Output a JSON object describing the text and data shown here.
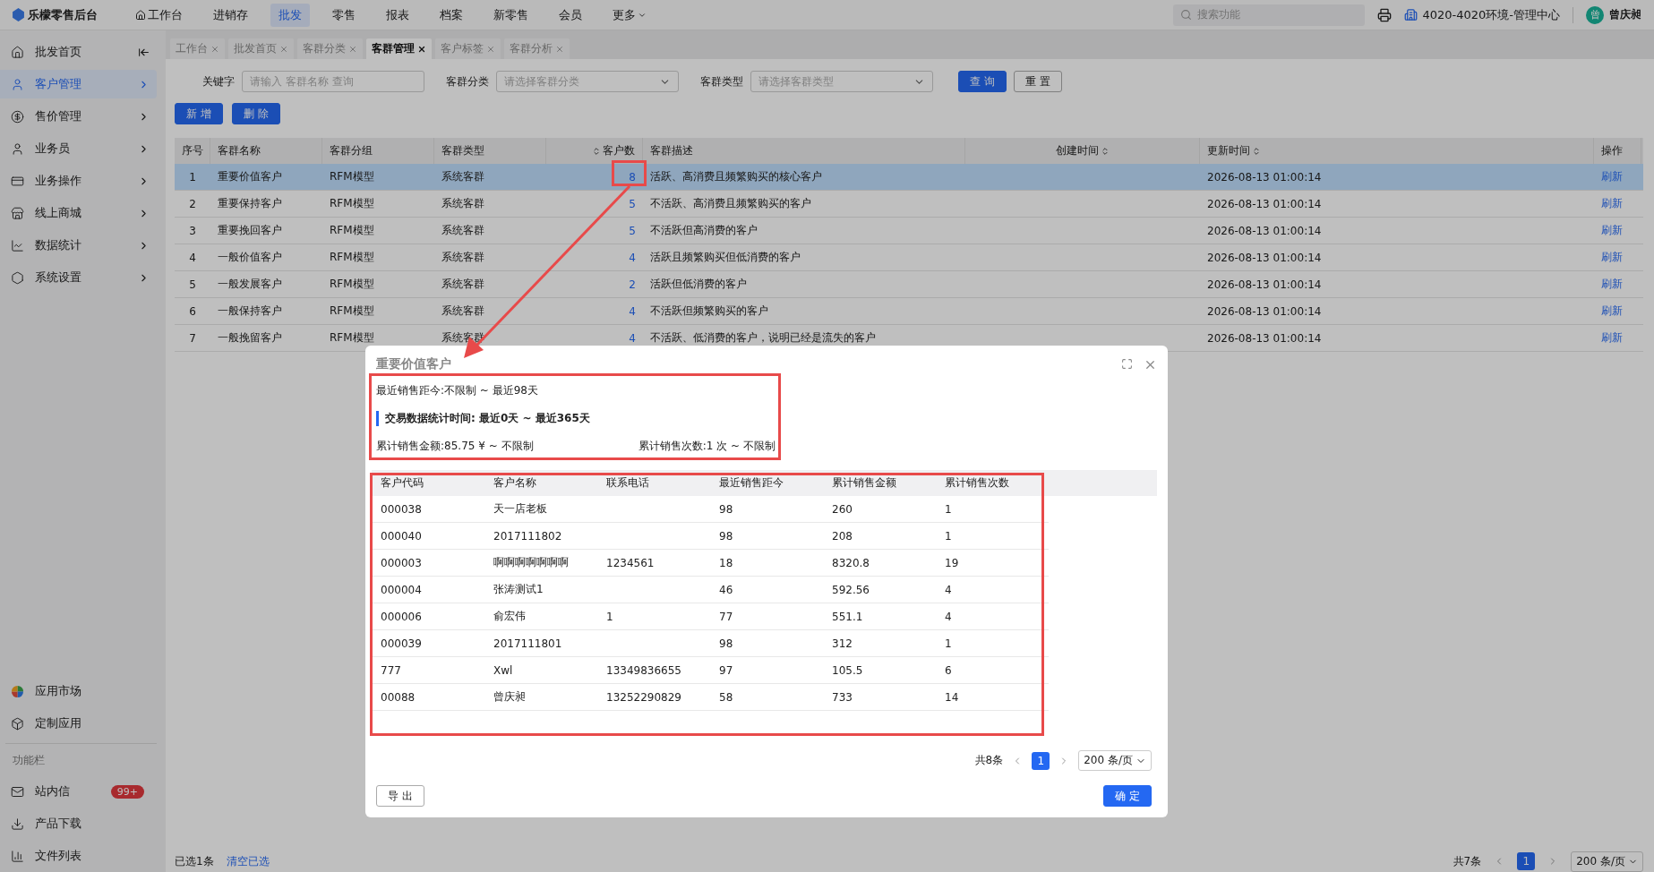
{
  "top_nav": {
    "brand": "乐檬零售后台",
    "items": [
      {
        "label": "工作台",
        "kind": "home",
        "selected": false
      },
      {
        "label": "进销存",
        "kind": "plain",
        "selected": false
      },
      {
        "label": "批发",
        "kind": "plain",
        "selected": true
      },
      {
        "label": "零售",
        "kind": "plain",
        "selected": false
      },
      {
        "label": "报表",
        "kind": "plain",
        "selected": false
      },
      {
        "label": "档案",
        "kind": "plain",
        "selected": false
      },
      {
        "label": "新零售",
        "kind": "plain",
        "selected": false
      },
      {
        "label": "会员",
        "kind": "plain",
        "selected": false
      },
      {
        "label": "更多",
        "kind": "more",
        "selected": false
      }
    ],
    "search": {
      "placeholder": "搜索功能"
    },
    "environment": "4020-4020环境-管理中心",
    "avatar": "曾",
    "user": "曾庆昶"
  },
  "sidebar": {
    "items": [
      {
        "label": "批发首页",
        "selected": false
      },
      {
        "label": "客户管理",
        "selected": true
      },
      {
        "label": "售价管理",
        "selected": false
      },
      {
        "label": "业务员",
        "selected": false
      },
      {
        "label": "业务操作",
        "selected": false
      },
      {
        "label": "线上商城",
        "selected": false
      },
      {
        "label": "数据统计",
        "selected": false
      },
      {
        "label": "系统设置",
        "selected": false
      }
    ],
    "apps": [
      {
        "label": "应用市场"
      },
      {
        "label": "定制应用"
      }
    ],
    "section_label": "功能栏",
    "tools": [
      {
        "label": "站内信",
        "badge": "99+"
      },
      {
        "label": "产品下载"
      },
      {
        "label": "文件列表"
      }
    ]
  },
  "tabs": [
    {
      "label": "工作台",
      "selected": false
    },
    {
      "label": "批发首页",
      "selected": false
    },
    {
      "label": "客群分类",
      "selected": false
    },
    {
      "label": "客群管理",
      "selected": true
    },
    {
      "label": "客户标签",
      "selected": false
    },
    {
      "label": "客群分析",
      "selected": false
    }
  ],
  "filters": [
    {
      "label": "关键字",
      "placeholder": "请输入 客群名称 查询",
      "kind": "input"
    },
    {
      "label": "客群分类",
      "placeholder": "请选择客群分类",
      "kind": "select"
    },
    {
      "label": "客群类型",
      "placeholder": "请选择客群类型",
      "kind": "select"
    }
  ],
  "filter_buttons": [
    {
      "label": "查 询",
      "kind": "primary"
    },
    {
      "label": "重 置",
      "kind": "default"
    }
  ],
  "actions": [
    "新 增",
    "删 除"
  ],
  "table": {
    "columns": [
      {
        "label": "序号",
        "sortable": false
      },
      {
        "label": "客群名称",
        "sortable": false
      },
      {
        "label": "客群分组",
        "sortable": false
      },
      {
        "label": "客群类型",
        "sortable": false
      },
      {
        "label": "客户数",
        "sortable": true
      },
      {
        "label": "客群描述",
        "sortable": false
      },
      {
        "label": "创建时间",
        "sortable": true
      },
      {
        "label": "更新时间",
        "sortable": true
      },
      {
        "label": "操作",
        "sortable": false
      }
    ],
    "rows": [
      {
        "index": "1",
        "name": "重要价值客户",
        "group": "RFM模型",
        "type": "系统客群",
        "count": "8",
        "description": "活跃、高消费且频繁购买的核心客户",
        "updated": "2026-08-13 01:00:14",
        "action": "刷新",
        "selected": true
      },
      {
        "index": "2",
        "name": "重要保持客户",
        "group": "RFM模型",
        "type": "系统客群",
        "count": "5",
        "description": "不活跃、高消费且频繁购买的客户",
        "updated": "2026-08-13 01:00:14",
        "action": "刷新",
        "selected": false
      },
      {
        "index": "3",
        "name": "重要挽回客户",
        "group": "RFM模型",
        "type": "系统客群",
        "count": "5",
        "description": "不活跃但高消费的客户",
        "updated": "2026-08-13 01:00:14",
        "action": "刷新",
        "selected": false
      },
      {
        "index": "4",
        "name": "一般价值客户",
        "group": "RFM模型",
        "type": "系统客群",
        "count": "4",
        "description": "活跃且频繁购买但低消费的客户",
        "updated": "2026-08-13 01:00:14",
        "action": "刷新",
        "selected": false
      },
      {
        "index": "5",
        "name": "一般发展客户",
        "group": "RFM模型",
        "type": "系统客群",
        "count": "2",
        "description": "活跃但低消费的客户",
        "updated": "2026-08-13 01:00:14",
        "action": "刷新",
        "selected": false
      },
      {
        "index": "6",
        "name": "一般保持客户",
        "group": "RFM模型",
        "type": "系统客群",
        "count": "4",
        "description": "不活跃但频繁购买的客户",
        "updated": "2026-08-13 01:00:14",
        "action": "刷新",
        "selected": false
      },
      {
        "index": "7",
        "name": "一般挽留客户",
        "group": "RFM模型",
        "type": "系统客群",
        "count": "4",
        "description": "不活跃、低消费的客户，说明已经是流失的客户",
        "updated": "2026-08-13 01:00:14",
        "action": "刷新",
        "selected": false
      }
    ]
  },
  "footer": {
    "selected_text": "已选1条",
    "clear_link": "清空已选",
    "total": "共7条",
    "pages": [
      {
        "label": "1",
        "selected": true
      }
    ],
    "page_size": "200 条/页"
  },
  "modal": {
    "title": "重要价值客户",
    "recency": "最近销售距今:不限制 ~ 最近98天",
    "section": "交易数据统计时间: 最近0天 ~ 最近365天",
    "amount": "累计销售金额:85.75 ¥ ~ 不限制",
    "times": "累计销售次数:1 次 ~ 不限制",
    "columns": [
      "客户代码",
      "客户名称",
      "联系电话",
      "最近销售距今",
      "累计销售金额",
      "累计销售次数"
    ],
    "rows": [
      [
        "000038",
        "天一店老板",
        "",
        "98",
        "260",
        "1"
      ],
      [
        "000040",
        "2017111802",
        "",
        "98",
        "208",
        "1"
      ],
      [
        "000003",
        "啊啊啊啊啊啊啊",
        "1234561",
        "18",
        "8320.8",
        "19"
      ],
      [
        "000004",
        "张涛测试1",
        "",
        "46",
        "592.56",
        "4"
      ],
      [
        "000006",
        "俞宏伟",
        "1",
        "77",
        "551.1",
        "4"
      ],
      [
        "000039",
        "2017111801",
        "",
        "98",
        "312",
        "1"
      ],
      [
        "777",
        "Xwl",
        "13349836655",
        "97",
        "105.5",
        "6"
      ],
      [
        "00088",
        "曾庆昶",
        "13252290829",
        "58",
        "733",
        "14"
      ]
    ],
    "total": "共8条",
    "pages": [
      {
        "label": "1",
        "selected": true
      }
    ],
    "page_size": "200 条/页",
    "export": "导 出",
    "confirm": "确 定"
  },
  "annotations": [
    {
      "kind": "frame"
    },
    {
      "kind": "frame"
    },
    {
      "kind": "frame"
    },
    {
      "kind": "arrow"
    }
  ]
}
